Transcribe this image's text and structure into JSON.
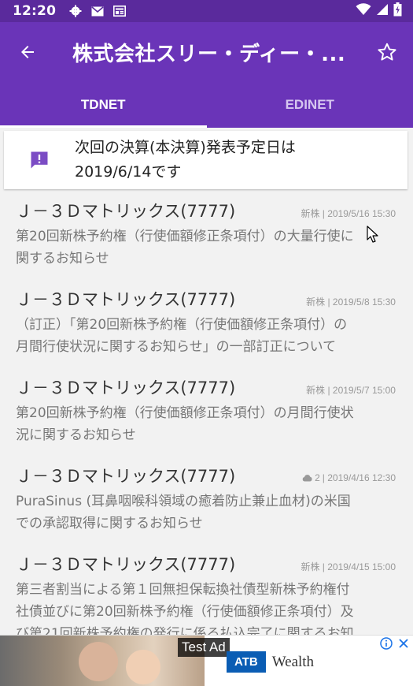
{
  "status_bar": {
    "time": "12:20"
  },
  "app_bar": {
    "title": "株式会社スリー・ディー・..."
  },
  "tabs": [
    {
      "label": "TDNET",
      "active": true
    },
    {
      "label": "EDINET",
      "active": false
    }
  ],
  "notice": {
    "line1": "次回の決算(本決算)発表予定日は",
    "line2": "2019/6/14です"
  },
  "items": [
    {
      "company": "Ｊ－３Ｄマトリックス(7777)",
      "meta": "新株 | 2019/5/16 15:30",
      "desc_line1": "第20回新株予約権（行使価額修正条項付）の大量行使に",
      "desc_line2": "関するお知らせ"
    },
    {
      "company": "Ｊ－３Ｄマトリックス(7777)",
      "meta": "新株 | 2019/5/8 15:30",
      "desc_line1": "（訂正）「第20回新株予約権（行使価額修正条項付）の",
      "desc_line2": "月間行使状況に関するお知らせ」の一部訂正について"
    },
    {
      "company": "Ｊ－３Ｄマトリックス(7777)",
      "meta": "新株 | 2019/5/7 15:00",
      "desc_line1": "第20回新株予約権（行使価額修正条項付）の月間行使状",
      "desc_line2": "況に関するお知らせ"
    },
    {
      "company": "Ｊ－３Ｄマトリックス(7777)",
      "meta_count": "2",
      "meta": "| 2019/4/16 12:30",
      "desc_line1": "PuraSinus (耳鼻咽喉科領域の癒着防止兼止血材)の米国",
      "desc_line2": "での承認取得に関するお知らせ"
    },
    {
      "company": "Ｊ－３Ｄマトリックス(7777)",
      "meta": "新株 | 2019/4/15 15:00",
      "desc_line1": "第三者割当による第１回無担保転換社債型新株予約権付",
      "desc_line2": "社債並びに第20回新株予約権（行使価額修正条項付）及",
      "desc_line3": "び第21回新株予約権の発行に係る払込完了に関するお知"
    }
  ],
  "ad": {
    "label": "Test Ad",
    "brand": "ATB",
    "brand_text": "Wealth"
  },
  "colors": {
    "primary": "#6a34b8",
    "status_bar": "#5a2a9c"
  }
}
